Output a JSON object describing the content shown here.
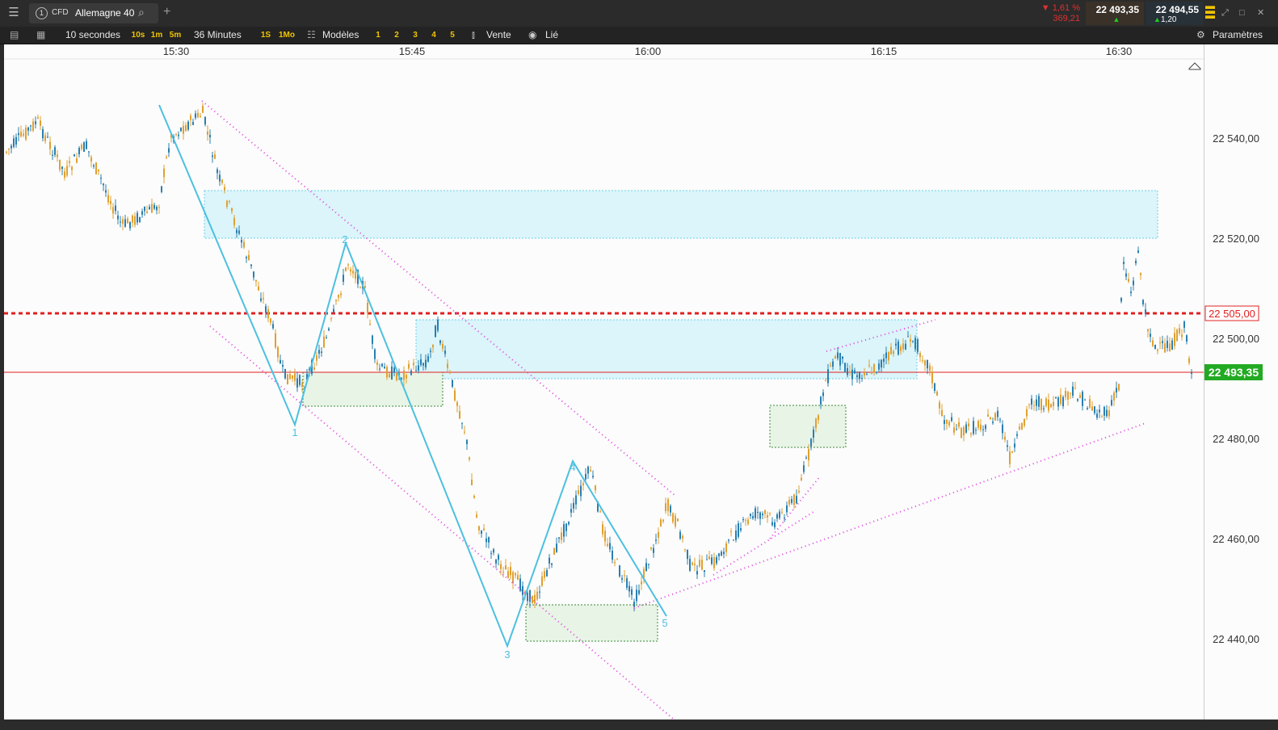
{
  "tab": {
    "number": "1",
    "type": "CFD",
    "name": "Allemagne 40"
  },
  "toolbar": {
    "interval": "10 secondes",
    "quick_intervals": [
      "10s",
      "1m",
      "5m"
    ],
    "range": "36 Minutes",
    "quick_ranges": [
      "1S",
      "1Mo"
    ],
    "templates": "Modèles",
    "layouts": [
      "1",
      "2",
      "3",
      "4",
      "5"
    ],
    "side": "Vente",
    "linked": "Lié",
    "settings": "Paramètres"
  },
  "quote": {
    "change_pct": "1,61 %",
    "change_abs": "369,21",
    "sell": "22 493,35",
    "buy": "22 494,55",
    "spread": "1,20"
  },
  "colors": {
    "up": "#2a7fb0",
    "down": "#e0a030",
    "cyan": "#4cc0e0",
    "magenta": "#e040e0",
    "red": "#e02020",
    "green_tag": "#22aa22"
  },
  "time_axis": [
    "15:30",
    "15:45",
    "16:00",
    "16:15",
    "16:30"
  ],
  "price_axis": [
    "22 540,00",
    "22 520,00",
    "22 500,00",
    "22 480,00",
    "22 460,00",
    "22 440,00"
  ],
  "alert_level": "22 505,00",
  "last_price": "22 493,35",
  "wave_labels": [
    "1",
    "2",
    "3",
    "4",
    "5"
  ]
}
